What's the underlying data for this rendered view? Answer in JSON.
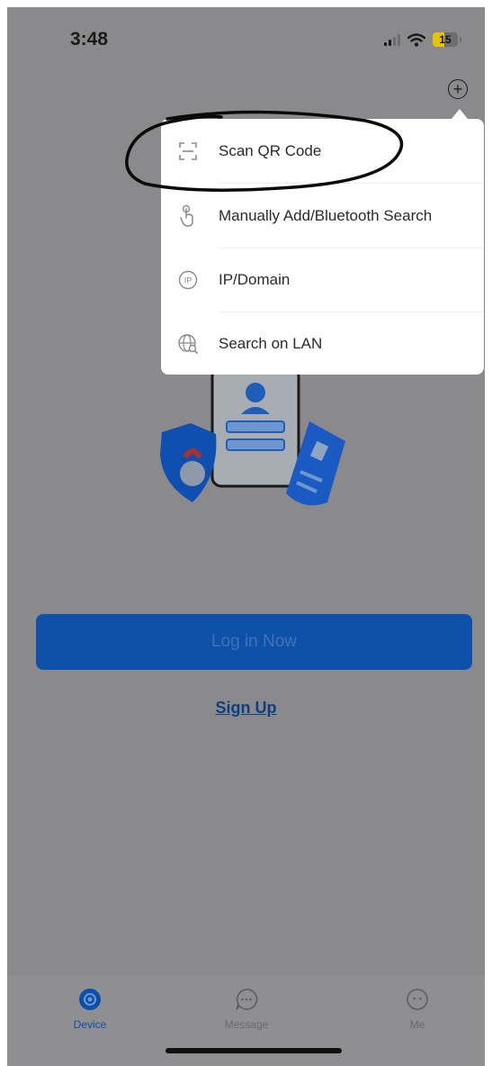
{
  "status_bar": {
    "time": "3:48",
    "battery": "15"
  },
  "menu": {
    "items": [
      {
        "label": "Scan QR Code",
        "icon": "scan-qr-icon"
      },
      {
        "label": "Manually Add/Bluetooth Search",
        "icon": "hand-tap-icon"
      },
      {
        "label": "IP/Domain",
        "icon": "ip-icon"
      },
      {
        "label": "Search on LAN",
        "icon": "globe-search-icon"
      }
    ]
  },
  "main": {
    "login_label": "Log in Now",
    "signup_label": "Sign Up"
  },
  "tabbar": {
    "tabs": [
      {
        "label": "Device",
        "icon": "device-icon",
        "active": true
      },
      {
        "label": "Message",
        "icon": "message-icon",
        "active": false
      },
      {
        "label": "Me",
        "icon": "me-icon",
        "active": false
      }
    ]
  },
  "colors": {
    "overlay": "#8a8a8c",
    "primary": "#0f51a8",
    "menu_bg": "#ffffff"
  }
}
